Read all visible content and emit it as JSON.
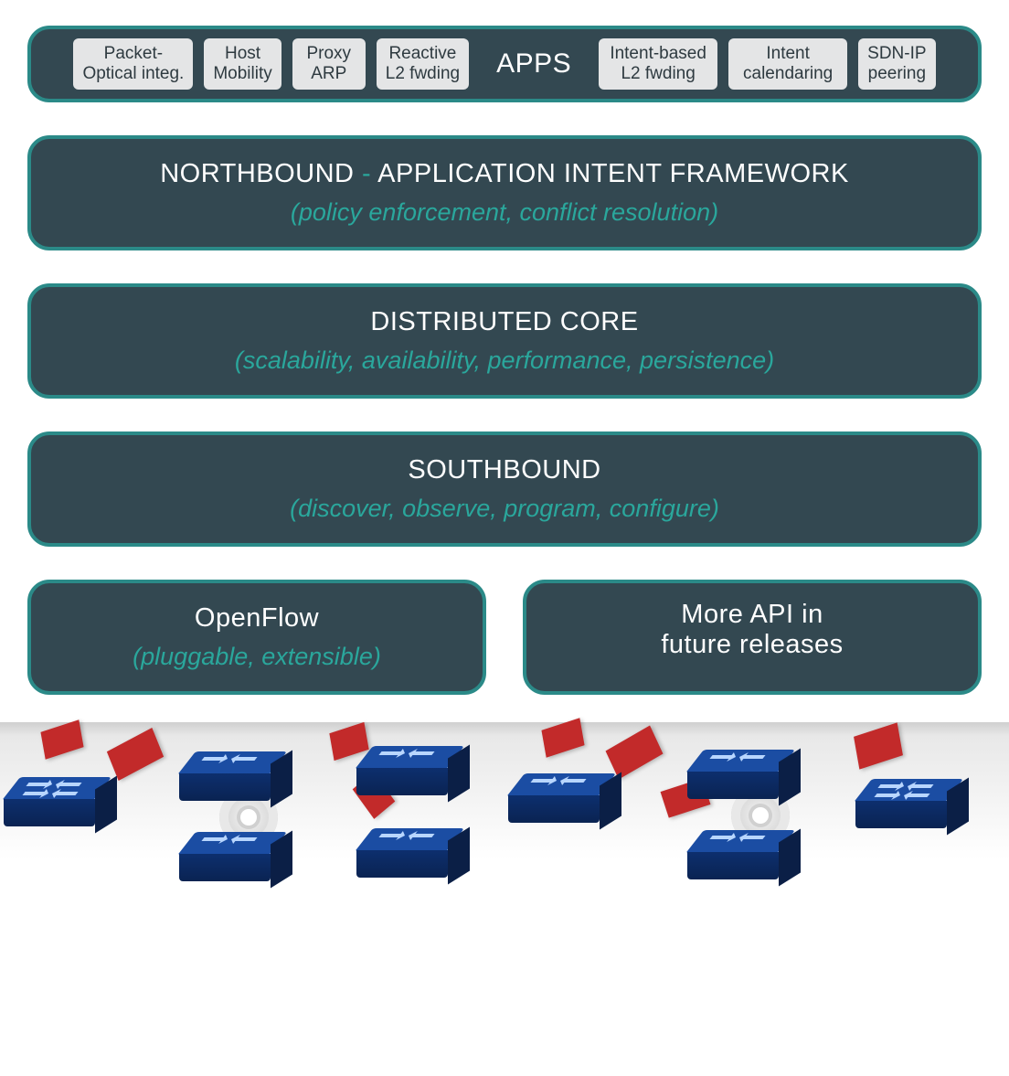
{
  "apps": {
    "title": "APPS",
    "chips_left": [
      {
        "l1": "Packet-",
        "l2": "Optical integ."
      },
      {
        "l1": "Host",
        "l2": "Mobility"
      },
      {
        "l1": "Proxy",
        "l2": "ARP"
      },
      {
        "l1": "Reactive",
        "l2": "L2 fwding"
      }
    ],
    "chips_right": [
      {
        "l1": "Intent-based",
        "l2": "L2 fwding"
      },
      {
        "l1": "Intent",
        "l2": "calendaring"
      },
      {
        "l1": "SDN-IP",
        "l2": "peering"
      }
    ]
  },
  "northbound": {
    "title_a": "NORTHBOUND",
    "sep": " - ",
    "title_b": "APPLICATION INTENT FRAMEWORK",
    "sub": "(policy enforcement, conflict resolution)"
  },
  "core": {
    "title": "DISTRIBUTED CORE",
    "sub": "(scalability, availability, performance, persistence)"
  },
  "southbound": {
    "title": "SOUTHBOUND",
    "sub": "(discover, observe, program, configure)"
  },
  "protocols": {
    "openflow": {
      "title": "OpenFlow",
      "sub": "(pluggable, extensible)"
    },
    "future": {
      "l1": "More API in",
      "l2": "future releases"
    }
  }
}
